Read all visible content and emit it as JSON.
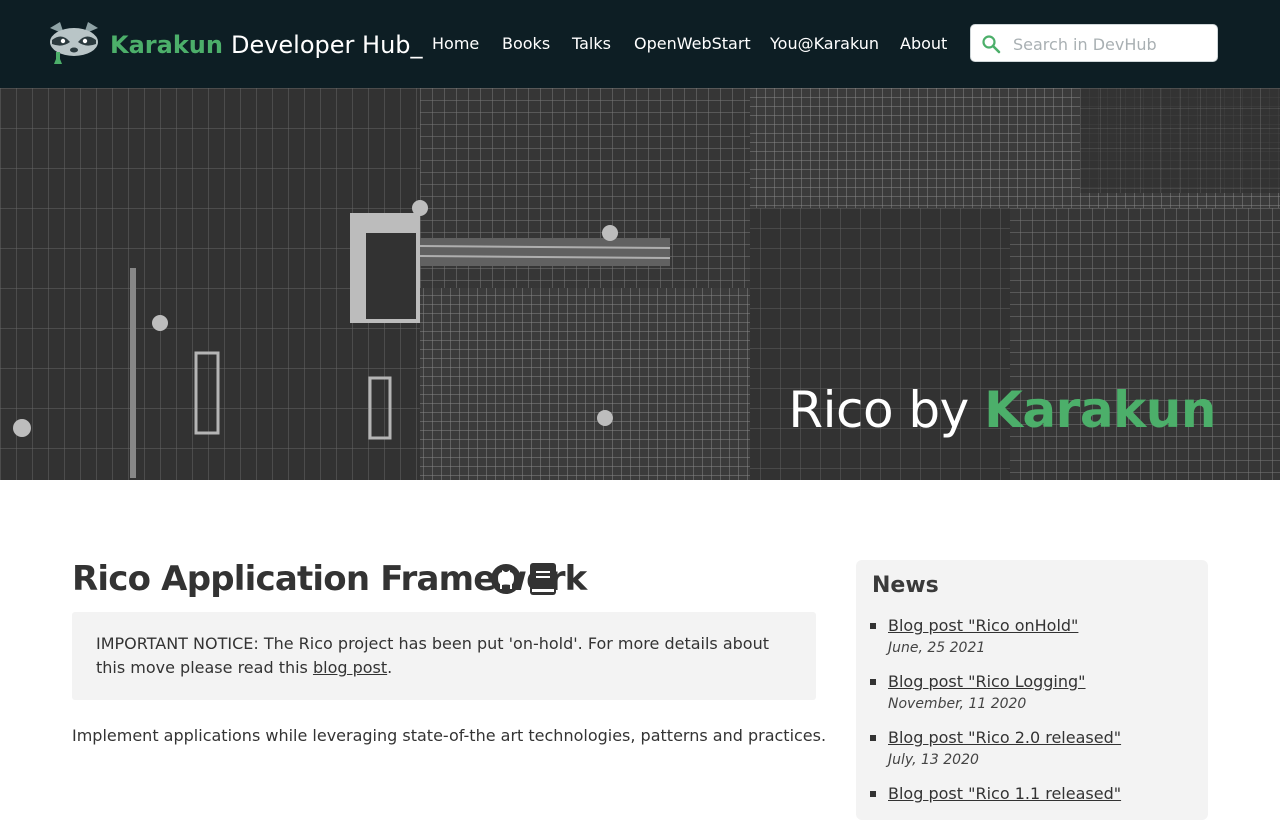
{
  "header": {
    "brand_strong": "Karakun",
    "brand_rest": "Developer Hub_",
    "nav": [
      {
        "label": "Home"
      },
      {
        "label": "Books"
      },
      {
        "label": "Talks"
      },
      {
        "label": "OpenWebStart"
      },
      {
        "label": "You@Karakun"
      },
      {
        "label": "About"
      }
    ],
    "search": {
      "placeholder": "Search in DevHub",
      "value": ""
    },
    "icons": {
      "logo": "raccoon-logo-icon",
      "search": "search-icon"
    }
  },
  "hero": {
    "title_plain": "Rico by ",
    "title_accent": "Karakun"
  },
  "main": {
    "title": "Rico Application Framework",
    "title_icons": [
      "github-icon",
      "book-icon"
    ],
    "notice_text": "IMPORTANT NOTICE: The Rico project has been put 'on-hold'. For more details about this move please read this ",
    "notice_link": "blog post",
    "notice_end": ".",
    "lead": "Implement applications while leveraging state-of-the art technologies, patterns and practices."
  },
  "news": {
    "heading": "News",
    "items": [
      {
        "title": "Blog post \"Rico onHold\"",
        "date": "June, 25 2021"
      },
      {
        "title": "Blog post \"Rico Logging\"",
        "date": "November, 11 2020"
      },
      {
        "title": "Blog post \"Rico 2.0 released\"",
        "date": "July, 13 2020"
      },
      {
        "title": "Blog post \"Rico 1.1 released\"",
        "date": ""
      }
    ]
  },
  "colors": {
    "header_bg": "#0d1e24",
    "brand_green": "#4caf6a",
    "panel_bg": "#f3f3f3",
    "text": "#333333"
  }
}
